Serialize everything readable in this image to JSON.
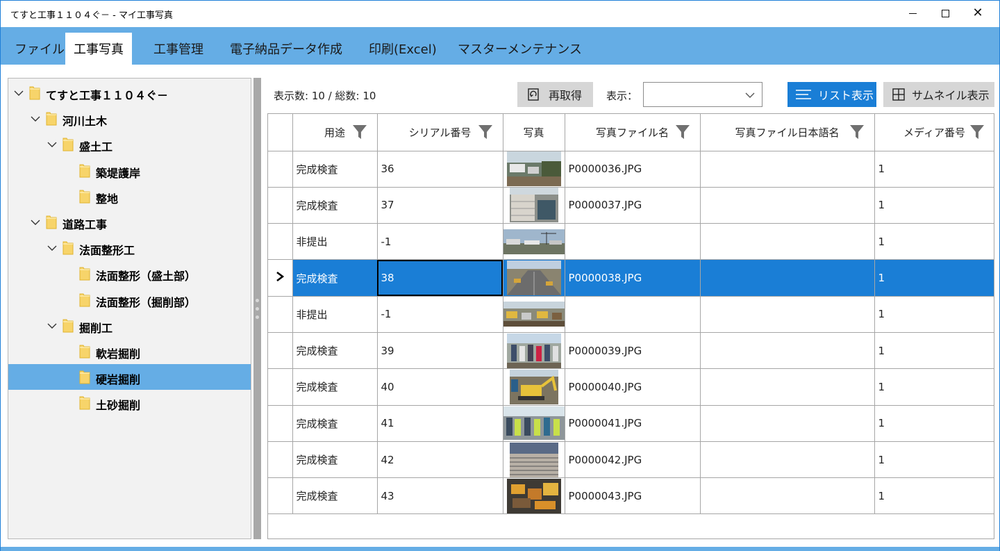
{
  "window": {
    "title": "てすと工事１１０４ぐ－ - マイ工事写真"
  },
  "menu": [
    {
      "label": "ファイル"
    },
    {
      "label": "工事写真"
    },
    {
      "label": "工事管理"
    },
    {
      "label": "電子納品データ作成"
    },
    {
      "label": "印刷(Excel)"
    },
    {
      "label": "マスターメンテナンス"
    }
  ],
  "tree": [
    {
      "label": "てすと工事１１０４ぐ－",
      "expanded": true
    },
    {
      "label": "河川土木",
      "expanded": true
    },
    {
      "label": "盛土工",
      "expanded": true
    },
    {
      "label": "築堤護岸"
    },
    {
      "label": "整地"
    },
    {
      "label": "道路工事",
      "expanded": true
    },
    {
      "label": "法面整形工",
      "expanded": true
    },
    {
      "label": "法面整形（盛土部）"
    },
    {
      "label": "法面整形（掘削部）"
    },
    {
      "label": "掘削工",
      "expanded": true
    },
    {
      "label": "軟岩掘削"
    },
    {
      "label": "硬岩掘削",
      "selected": true
    },
    {
      "label": "土砂掘削"
    }
  ],
  "toolbar": {
    "count_text": "表示数: 10 /  総数: 10",
    "refresh_label": "再取得",
    "display_label": "表示：",
    "display_value": "",
    "list_view_label": "リスト表示",
    "thumbnail_view_label": "サムネイル表示"
  },
  "grid": {
    "columns": [
      "用途",
      "シリアル番号",
      "写真",
      "写真ファイル名",
      "写真ファイル日本語名",
      "メディア番号"
    ],
    "rows": [
      {
        "usage": "完成検査",
        "serial": "36",
        "file": "P0000036.JPG",
        "jp_name": "",
        "media": "1",
        "photo": "construction-site-trucks"
      },
      {
        "usage": "完成検査",
        "serial": "37",
        "file": "P0000037.JPG",
        "jp_name": "",
        "media": "1",
        "photo": "retaining-wall"
      },
      {
        "usage": "非提出",
        "serial": "-1",
        "file": "",
        "jp_name": "",
        "media": "1",
        "photo": "site-panorama-crane"
      },
      {
        "usage": "完成検査",
        "serial": "38",
        "file": "P0000038.JPG",
        "jp_name": "",
        "media": "1",
        "photo": "road-excavation",
        "selected": true
      },
      {
        "usage": "非提出",
        "serial": "-1",
        "file": "",
        "jp_name": "",
        "media": "1",
        "photo": "site-panorama-machines"
      },
      {
        "usage": "完成検査",
        "serial": "39",
        "file": "P0000039.JPG",
        "jp_name": "",
        "media": "1",
        "photo": "workers-group"
      },
      {
        "usage": "完成検査",
        "serial": "40",
        "file": "P0000040.JPG",
        "jp_name": "",
        "media": "1",
        "photo": "excavator-yellow"
      },
      {
        "usage": "完成検査",
        "serial": "41",
        "file": "P0000041.JPG",
        "jp_name": "",
        "media": "1",
        "photo": "workers-vests"
      },
      {
        "usage": "完成検査",
        "serial": "42",
        "file": "P0000042.JPG",
        "jp_name": "",
        "media": "1",
        "photo": "rebar-field"
      },
      {
        "usage": "完成検査",
        "serial": "43",
        "file": "P0000043.JPG",
        "jp_name": "",
        "media": "1",
        "photo": "heavy-machinery"
      }
    ]
  },
  "colors": {
    "accent": "#1a7ed6",
    "menubar": "#65ade5",
    "tree_bg": "#f2f2f2"
  }
}
